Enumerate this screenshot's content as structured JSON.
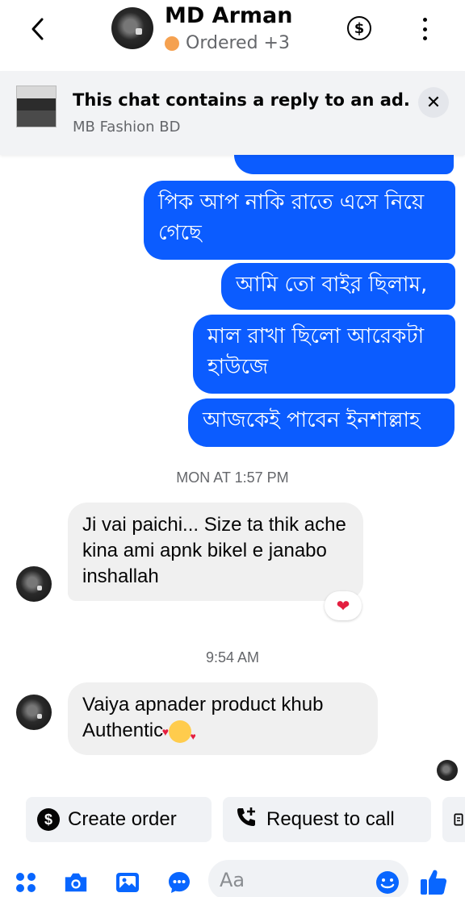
{
  "header": {
    "title": "MD Arman",
    "status": "Ordered +3",
    "status_color": "#f5a150"
  },
  "ad_banner": {
    "title": "This chat contains a reply to an ad.",
    "subtitle": "MB Fashion BD"
  },
  "messages": {
    "out_1": "পিক আপ নাকি রাতে এসে নিয়ে গেছে",
    "out_2": "আমি তো বাইর় ছিলাম,",
    "out_3": "মাল রাখা ছিলো আরেকটা হাউজে",
    "out_4": "আজকেই পাবেন ইনশাল্লাহ",
    "time_1": "MON AT 1:57 PM",
    "in_1": "Ji vai paichi... Size ta thik ache kina ami apnk bikel e janabo inshallah",
    "reaction": "❤",
    "time_2": "9:54 AM",
    "in_2": "Vaiya apnader product khub Authentic"
  },
  "quick_actions": {
    "create_order": "Create order",
    "request_call": "Request to call"
  },
  "composer": {
    "placeholder": "Aa"
  },
  "colors": {
    "outgoing_bubble": "#0b5cff",
    "incoming_bubble": "#f0f0f0",
    "accent": "#0866ff"
  }
}
